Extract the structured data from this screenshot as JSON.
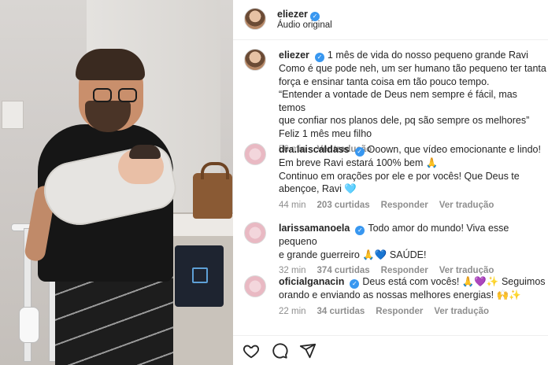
{
  "post": {
    "username": "eliezer",
    "audio": "Áudio original"
  },
  "caption": {
    "username": "eliezer",
    "lines": [
      "1 mês de vida do nosso pequeno grande Ravi",
      "Como é que pode neh, um ser humano tão pequeno ter tanta",
      "força e ensinar tanta coisa em tão pouco tempo.",
      "“Entender a vontade de Deus nem sempre é fácil, mas temos",
      "que confiar nos planos dele, pq são sempre os melhores”",
      "Feliz 1 mês meu filho"
    ],
    "time": "56 min",
    "translate": "Ver tradução"
  },
  "comments": [
    {
      "username": "dra.laiscaldass",
      "verified": true,
      "lines": [
        "Ooown, que vídeo emocionante e lindo!",
        "Em breve Ravi estará 100% bem 🙏",
        "Continuo em orações por ele e por vocês! Que Deus te",
        "abençoe, Ravi 🩵"
      ],
      "time": "44 min",
      "likes": "203 curtidas",
      "reply": "Responder",
      "translate": "Ver tradução"
    },
    {
      "username": "larissamanoela",
      "verified": true,
      "lines": [
        "Todo amor do mundo! Viva esse pequeno",
        "e grande guerreiro 🙏💙 SAÚDE!"
      ],
      "time": "32 min",
      "likes": "374 curtidas",
      "reply": "Responder",
      "translate": "Ver tradução"
    },
    {
      "username": "oficialganacin",
      "verified": true,
      "lines": [
        "Deus está com vocês! 🙏💜✨ Seguimos",
        "orando e enviando as nossas melhores energias! 🙌✨"
      ],
      "time": "22 min",
      "likes": "34 curtidas",
      "reply": "Responder",
      "translate": "Ver tradução"
    }
  ],
  "icons": {
    "like": "heart-icon",
    "comment": "comment-icon",
    "share": "send-icon"
  },
  "colors": {
    "verified": "#3897f0",
    "muted": "#8e8e8e",
    "text": "#262626"
  }
}
